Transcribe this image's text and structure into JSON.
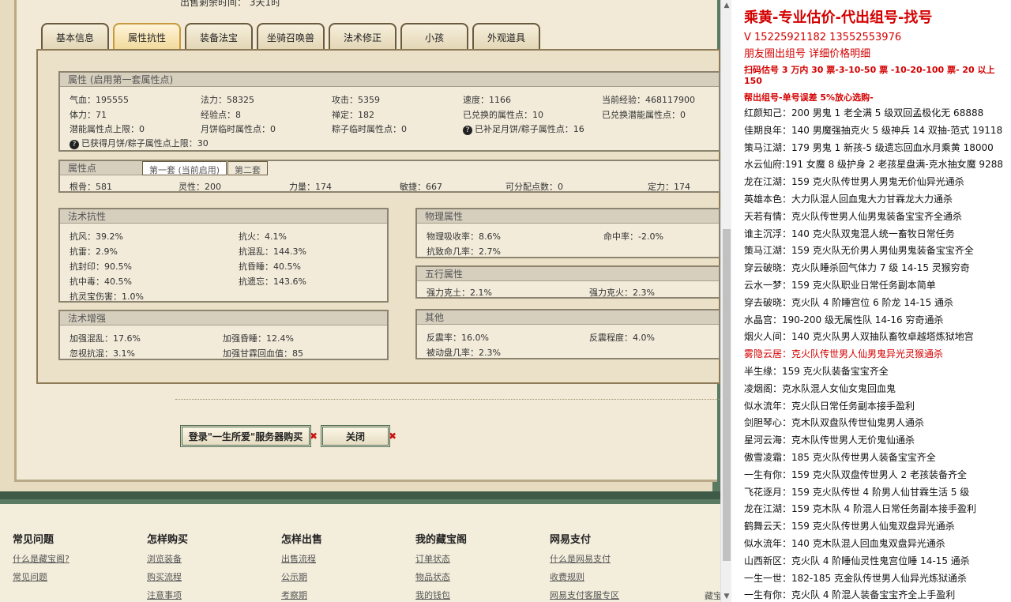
{
  "sale_time": "出售剩余时间：  3天1时",
  "tabs": [
    "基本信息",
    "属性抗性",
    "装备法宝",
    "坐骑召唤兽",
    "法术修正",
    "小孩",
    "外观道具"
  ],
  "attr_section": {
    "title": "属性 (启用第一套属性点)",
    "row1": [
      "气血：195555",
      "法力：58325",
      "攻击：5359",
      "速度：1166",
      "当前经验：468117900"
    ],
    "row2": [
      "体力：71",
      "经验点：8",
      "禅定：182",
      "已兑换的属性点：10",
      "已兑换潜能属性点：0"
    ],
    "row3": [
      "潜能属性点上限：0",
      "月饼临时属性点：0",
      "粽子临时属性点：0",
      "已补足月饼/粽子属性点：16"
    ],
    "row4": "已获得月饼/粽子属性点上限：30"
  },
  "points_section": {
    "title": "属性点",
    "subtab1": "第一套 (当前启用)",
    "subtab2": "第二套",
    "values": [
      "根骨：581",
      "灵性：200",
      "力量：174",
      "敏捷：667",
      "可分配点数：0",
      "定力：174"
    ]
  },
  "resist_section": {
    "title": "法术抗性",
    "left": [
      "抗风：39.2%",
      "抗雷：2.9%",
      "抗封印：90.5%",
      "抗中毒：40.5%",
      "抗灵宝伤害：1.0%"
    ],
    "right": [
      "抗火：4.1%",
      "抗混乱：144.3%",
      "抗昏睡：40.5%",
      "抗遗忘：143.6%"
    ]
  },
  "physical_section": {
    "title": "物理属性",
    "items": [
      "物理吸收率：8.6%",
      "命中率：-2.0%",
      "抗致命几率：2.7%"
    ]
  },
  "five_section": {
    "title": "五行属性",
    "items": [
      "强力克土：2.1%",
      "强力克火：2.3%"
    ]
  },
  "enhance_section": {
    "title": "法术增强",
    "items": [
      "加强混乱：17.6%",
      "加强昏睡：12.4%",
      "忽视抗混：3.1%",
      "加强甘霖回血值：85"
    ]
  },
  "other_section": {
    "title": "其他",
    "items": [
      "反震率：16.0%",
      "反震程度：4.0%",
      "被动盘几率：2.3%"
    ]
  },
  "buttons": {
    "login_label": "登录\"一生所爱\"服务器购买",
    "close_label": "关闭"
  },
  "footer": {
    "col1": {
      "title": "常见问题",
      "links": [
        "什么是藏宝阁?",
        "常见问题"
      ]
    },
    "col2": {
      "title": "怎样购买",
      "links": [
        "浏览装备",
        "购买流程",
        "注意事项"
      ]
    },
    "col3": {
      "title": "怎样出售",
      "links": [
        "出售流程",
        "公示期",
        "考察期"
      ]
    },
    "col4": {
      "title": "我的藏宝阁",
      "links": [
        "订单状态",
        "物品状态",
        "我的钱包"
      ]
    },
    "col5": {
      "title": "网易支付",
      "links": [
        "什么是网易支付",
        "收费规则",
        "网易支付客服专区"
      ]
    },
    "corner": "藏宝"
  },
  "right_pane": {
    "title": "乘黄-专业估价-代出组号-找号",
    "contact": "V 15225921182   13552553976",
    "line_pyq": "朋友圈出组号    详细价格明细",
    "line_scan": "扫码估号 3 万内 30 票-3-10-50 票   -10-20-100 票- 20 以上 150",
    "line_help": "帮出组号-单号误差 5%放心选购-",
    "entries": [
      {
        "text": "红颜知己：200 男鬼 1 老全满 5 级双回孟极化无 68888",
        "red": false
      },
      {
        "text": "佳期良年：140 男魔强抽克火 5 级神兵 14 双抽-范式 19118",
        "red": false
      },
      {
        "text": "策马江湖：179 男鬼 1 新孩-5 级遗忘回血水月乘黄 18000",
        "red": false
      },
      {
        "text": "水云仙府:191 女魔 8 级护身 2 老孩星盘满-克水抽女魔 9288",
        "red": false
      },
      {
        "text": "龙在江湖：159 克火队传世男人男鬼无价仙异光通杀",
        "red": false
      },
      {
        "text": "英雄本色：大力队混人回血鬼大力甘霖龙大力通杀",
        "red": false
      },
      {
        "text": "天若有情：克火队传世男人仙男鬼装备宝宝齐全通杀",
        "red": false
      },
      {
        "text": "谁主沉浮：140 克火队双鬼混人统一畜牧日常任务",
        "red": false
      },
      {
        "text": "策马江湖：159 克火队无价男人男仙男鬼装备宝宝齐全",
        "red": false
      },
      {
        "text": "穿云破晓：克火队睡杀回气体力 7 级 14-15 灵猴穷奇",
        "red": false
      },
      {
        "text": "云水一梦：159 克火队职业日常任务副本简单",
        "red": false
      },
      {
        "text": "穿去破晓：克火队 4 阶睡宫位 6 阶龙 14-15 通杀",
        "red": false
      },
      {
        "text": "水晶宫：190-200 级无属性队 14-16 穷奇通杀",
        "red": false
      },
      {
        "text": "烟火人间：140 克火队男人双抽队畜牧卓越塔炼狱地宫",
        "red": false
      },
      {
        "text": "雾隐云居：克火队传世男人仙男鬼异光灵猴通杀",
        "red": true
      },
      {
        "text": "半生缘：159 克火队装备宝宝齐全",
        "red": false
      },
      {
        "text": "凌烟阁：克水队混人女仙女鬼回血鬼",
        "red": false
      },
      {
        "text": "似水流年：克火队日常任务副本接手盈利",
        "red": false
      },
      {
        "text": "剑胆琴心：克木队双盘队传世仙鬼男人通杀",
        "red": false
      },
      {
        "text": "星河云海：克木队传世男人无价鬼仙通杀",
        "red": false
      },
      {
        "text": "傲雪凌霜：185 克火队传世男人装备宝宝齐全",
        "red": false
      },
      {
        "text": "一生有你：159 克火队双盘传世男人 2 老孩装备齐全",
        "red": false
      },
      {
        "text": "飞花逐月：159 克火队传世 4 阶男人仙甘霖生活 5 级",
        "red": false
      },
      {
        "text": "龙在江湖：159 克木队 4 阶混人日常任务副本接手盈利",
        "red": false
      },
      {
        "text": "鹤舞云天：159 克火队传世男人仙鬼双盘异光通杀",
        "red": false
      },
      {
        "text": "似水流年：140 克木队混人回血鬼双盘异光通杀",
        "red": false
      },
      {
        "text": "山西新区：克火队 4 阶睡仙灵性鬼宫位睡 14-15 通杀",
        "red": false
      },
      {
        "text": "一生一世：182-185 克金队传世男人仙异光炼狱通杀",
        "red": false
      },
      {
        "text": "一生有你：克火队 4 阶混人装备宝宝齐全上手盈利",
        "red": false
      }
    ]
  }
}
